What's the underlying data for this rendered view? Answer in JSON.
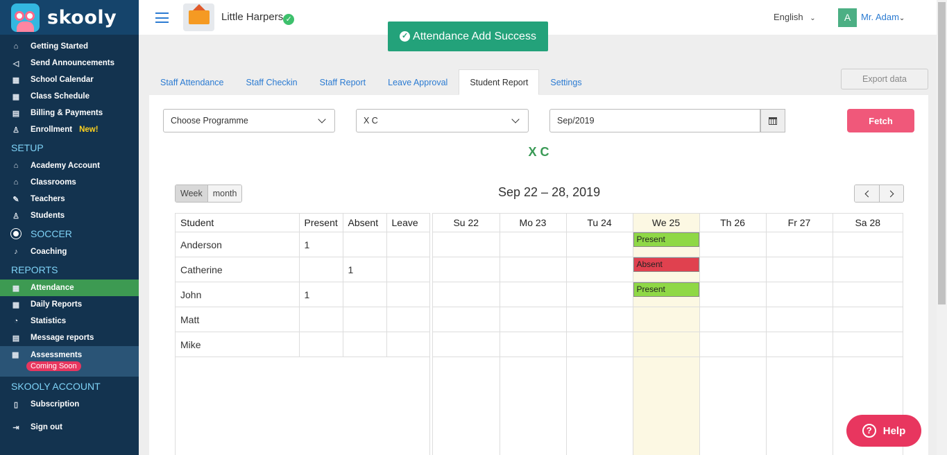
{
  "brand": {
    "name": "skooly"
  },
  "sidebar": {
    "items_top": [
      {
        "label": "Getting Started",
        "icon": "home-icon",
        "glyph": "⌂"
      },
      {
        "label": "Send Announcements",
        "icon": "megaphone-icon",
        "glyph": "◁"
      },
      {
        "label": "School Calendar",
        "icon": "calendar-icon",
        "glyph": "▦"
      },
      {
        "label": "Class Schedule",
        "icon": "calendar-icon",
        "glyph": "▦"
      },
      {
        "label": "Billing & Payments",
        "icon": "billing-icon",
        "glyph": "▤"
      },
      {
        "label": "Enrollment",
        "icon": "enroll-icon",
        "glyph": "♙",
        "badge": "New!"
      }
    ],
    "setup_title": "SETUP",
    "items_setup": [
      {
        "label": "Academy Account",
        "icon": "academy-icon",
        "glyph": "⌂"
      },
      {
        "label": "Classrooms",
        "icon": "classroom-icon",
        "glyph": "⌂"
      },
      {
        "label": "Teachers",
        "icon": "teacher-icon",
        "glyph": "✎"
      },
      {
        "label": "Students",
        "icon": "student-icon",
        "glyph": "♙"
      }
    ],
    "soccer_title": "SOCCER",
    "items_soccer": [
      {
        "label": "Coaching",
        "icon": "whistle-icon",
        "glyph": "♪"
      }
    ],
    "reports_title": "REPORTS",
    "items_reports": [
      {
        "label": "Attendance",
        "icon": "attendance-icon",
        "glyph": "▦",
        "active": true
      },
      {
        "label": "Daily Reports",
        "icon": "daily-report-icon",
        "glyph": "▦"
      },
      {
        "label": "Statistics",
        "icon": "statistics-icon",
        "glyph": "◔"
      },
      {
        "label": "Message reports",
        "icon": "message-icon",
        "glyph": "▤"
      }
    ],
    "assessments": {
      "label": "Assessments",
      "badge": "Coming Soon",
      "glyph": "▦"
    },
    "account_title": "SKOOLY ACCOUNT",
    "items_account": [
      {
        "label": "Subscription",
        "icon": "bookmark-icon",
        "glyph": "▯"
      }
    ],
    "signout": {
      "label": "Sign out",
      "icon": "signout-icon",
      "glyph": "⇥"
    }
  },
  "header": {
    "school_name": "Little Harpers",
    "language": "English",
    "avatar_letter": "A",
    "user": "Mr. Adam"
  },
  "toast": {
    "text": "Attendance Add Success"
  },
  "tabs": [
    {
      "label": "Staff Attendance"
    },
    {
      "label": "Staff Checkin"
    },
    {
      "label": "Staff Report"
    },
    {
      "label": "Leave Approval"
    },
    {
      "label": "Student Report",
      "active": true
    },
    {
      "label": "Settings"
    }
  ],
  "export_label": "Export data",
  "filters": {
    "programme": "Choose Programme",
    "class": "X C",
    "month": "Sep/2019",
    "fetch_label": "Fetch"
  },
  "class_title": "X C",
  "calendar": {
    "view_week": "Week",
    "view_month": "month",
    "range": "Sep 22 – 28, 2019",
    "days": [
      "Su 22",
      "Mo 23",
      "Tu 24",
      "We 25",
      "Th 26",
      "Fr 27",
      "Sa 28"
    ],
    "today_index": 3
  },
  "summary": {
    "headers": [
      "Student",
      "Present",
      "Absent",
      "Leave"
    ],
    "rows": [
      {
        "student": "Anderson",
        "present": "1",
        "absent": "",
        "leave": ""
      },
      {
        "student": "Catherine",
        "present": "",
        "absent": "1",
        "leave": ""
      },
      {
        "student": "John",
        "present": "1",
        "absent": "",
        "leave": ""
      },
      {
        "student": "Matt",
        "present": "",
        "absent": "",
        "leave": ""
      },
      {
        "student": "Mike",
        "present": "",
        "absent": "",
        "leave": ""
      }
    ]
  },
  "events": [
    {
      "row": 0,
      "day": 3,
      "label": "Present",
      "color": "#8fd846"
    },
    {
      "row": 1,
      "day": 3,
      "label": "Absent",
      "color": "#e0414f"
    },
    {
      "row": 2,
      "day": 3,
      "label": "Present",
      "color": "#8fd846"
    }
  ],
  "help_label": "Help"
}
